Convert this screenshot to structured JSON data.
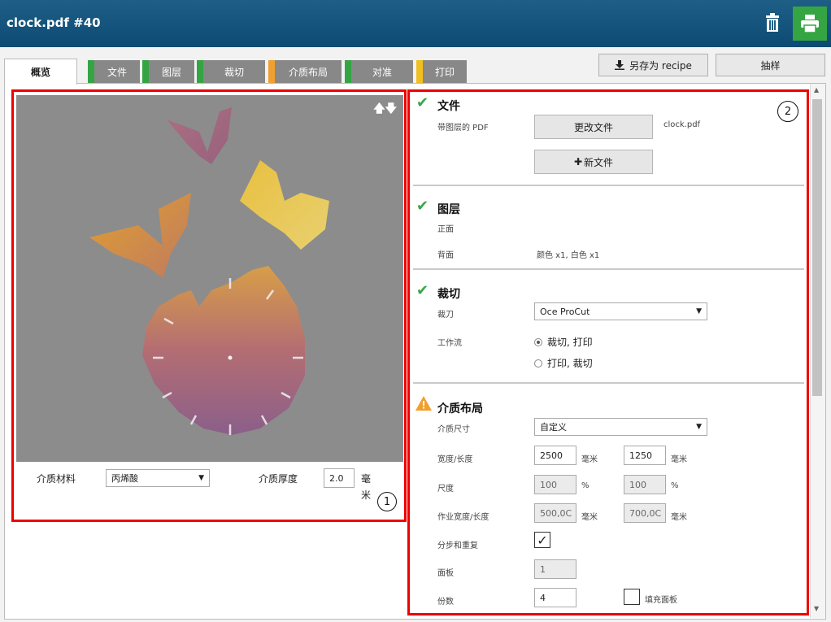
{
  "window": {
    "title": "clock.pdf #40"
  },
  "colors": {
    "title_bar": "#0c4a73",
    "print_button": "#35a543",
    "highlight": "#e00000",
    "check": "#3aa54a",
    "warning": "#f0a030",
    "tab_green": "#35a543",
    "tab_orange": "#f0a030",
    "tab_yellow": "#f0c020"
  },
  "icons": {
    "trash": "trash-icon",
    "print": "printer-icon",
    "download": "download-icon",
    "plus": "plus-icon",
    "check": "check-icon",
    "warning": "warning-icon",
    "arrows": "up-down-arrows-icon"
  },
  "tabs": [
    {
      "label": "概览",
      "active": true
    },
    {
      "label": "文件",
      "status": "green"
    },
    {
      "label": "图层",
      "status": "green"
    },
    {
      "label": "裁切",
      "status": "green"
    },
    {
      "label": "介质布局",
      "status": "orange"
    },
    {
      "label": "对准",
      "status": "green"
    },
    {
      "label": "打印",
      "status": "yellow"
    }
  ],
  "toolbar": {
    "save_recipe": "另存为 recipe",
    "sample": "抽样"
  },
  "left": {
    "media_material_label": "介质材料",
    "media_material_value": "丙烯酸",
    "media_thickness_label": "介质厚度",
    "media_thickness_value": "2.0",
    "unit_mm_line1": "毫",
    "unit_mm_line2": "米",
    "callout": "1"
  },
  "right": {
    "callout": "2",
    "file": {
      "title": "文件",
      "pdf_label": "带图层的 PDF",
      "change_button": "更改文件",
      "filename": "clock.pdf",
      "new_button": "新文件"
    },
    "layers": {
      "title": "图层",
      "front_label": "正面",
      "back_label": "背面",
      "back_value": "颜色 x1, 白色 x1"
    },
    "cutting": {
      "title": "裁切",
      "blade_label": "裁刀",
      "blade_value": "Oce ProCut",
      "workflow_label": "工作流",
      "opt1": "裁切, 打印",
      "opt2": "打印, 裁切"
    },
    "media_layout": {
      "title": "介质布局",
      "size_label": "介质尺寸",
      "size_value": "自定义",
      "wl_label": "宽度/长度",
      "width": "2500",
      "length": "1250",
      "unit": "毫米",
      "scale_label": "尺度",
      "scale_x": "100",
      "scale_y": "100",
      "pct": "%",
      "job_label": "作业宽度/长度",
      "job_w": "500,0C",
      "job_h": "700,0C",
      "step_label": "分步和重复",
      "step_checked": "✓",
      "panel_label": "面板",
      "panel_value": "1",
      "copies_label": "份数",
      "copies_value": "4",
      "fill_panel_label": "填充面板"
    }
  }
}
